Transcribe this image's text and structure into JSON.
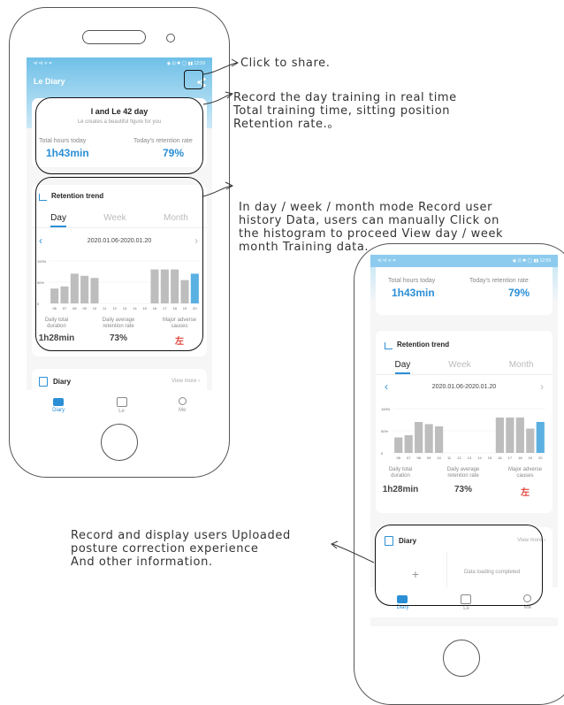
{
  "colors": {
    "accent": "#2b8fd6",
    "bar_highlight": "#5bb0e2",
    "bar_normal": "#bdbdbd",
    "red": "#e0423a"
  },
  "annotations": {
    "share": "Click to share.",
    "record": "Record the day training in real time\nTotal training time, sitting position\nRetention rate.。",
    "history": "In day / week / month mode Record user\nhistory Data, users can manually Click on\nthe histogram to proceed View day / week\nmonth Training data.",
    "diary": "Record and display users Uploaded\nposture correction experience\nAnd other information."
  },
  "phone1": {
    "status_left": "ᵃıl ᵃıl ᯤ ⌗",
    "status_right": "◉ ⊡ ✱ ◯ ▮▮ 12:59",
    "app_title": "Le Diary",
    "greeting_title": "I and Le 42 day",
    "greeting_sub": "Le creates a beautiful figure for you",
    "total_label": "Total hours today",
    "total_value": "1h43min",
    "retention_label": "Today's retention rate",
    "retention_value": "79%"
  },
  "trend": {
    "title": "Retention trend",
    "tabs": [
      "Day",
      "Week",
      "Month"
    ],
    "date_range": "2020.01.06-2020.01.20",
    "y_ticks": [
      "100%",
      "50%",
      "0"
    ],
    "x_labels": [
      "06",
      "07",
      "08",
      "09",
      "10",
      "11",
      "12",
      "13",
      "14",
      "15",
      "16",
      "17",
      "18",
      "19",
      "20"
    ],
    "stat1_label": "Daily total duration",
    "stat1_value": "1h28min",
    "stat2_label": "Daily average retention rate",
    "stat2_value": "73%",
    "stat3_label": "Major adverse causes",
    "stat3_value": "左"
  },
  "chart_data": {
    "type": "bar",
    "categories": [
      "06",
      "07",
      "08",
      "09",
      "10",
      "11",
      "12",
      "13",
      "14",
      "15",
      "16",
      "17",
      "18",
      "19",
      "20"
    ],
    "values": [
      35,
      40,
      70,
      65,
      60,
      0,
      0,
      0,
      0,
      0,
      80,
      80,
      80,
      55,
      70
    ],
    "highlight_index": 14,
    "ylim": [
      0,
      100
    ],
    "y_ticks": [
      "100%",
      "50%",
      "0"
    ]
  },
  "diary": {
    "label": "Diary",
    "view_more": "View more ›",
    "loading": "Data loading completed",
    "add": "+"
  },
  "nav": [
    "Diary",
    "Le",
    "Me"
  ]
}
